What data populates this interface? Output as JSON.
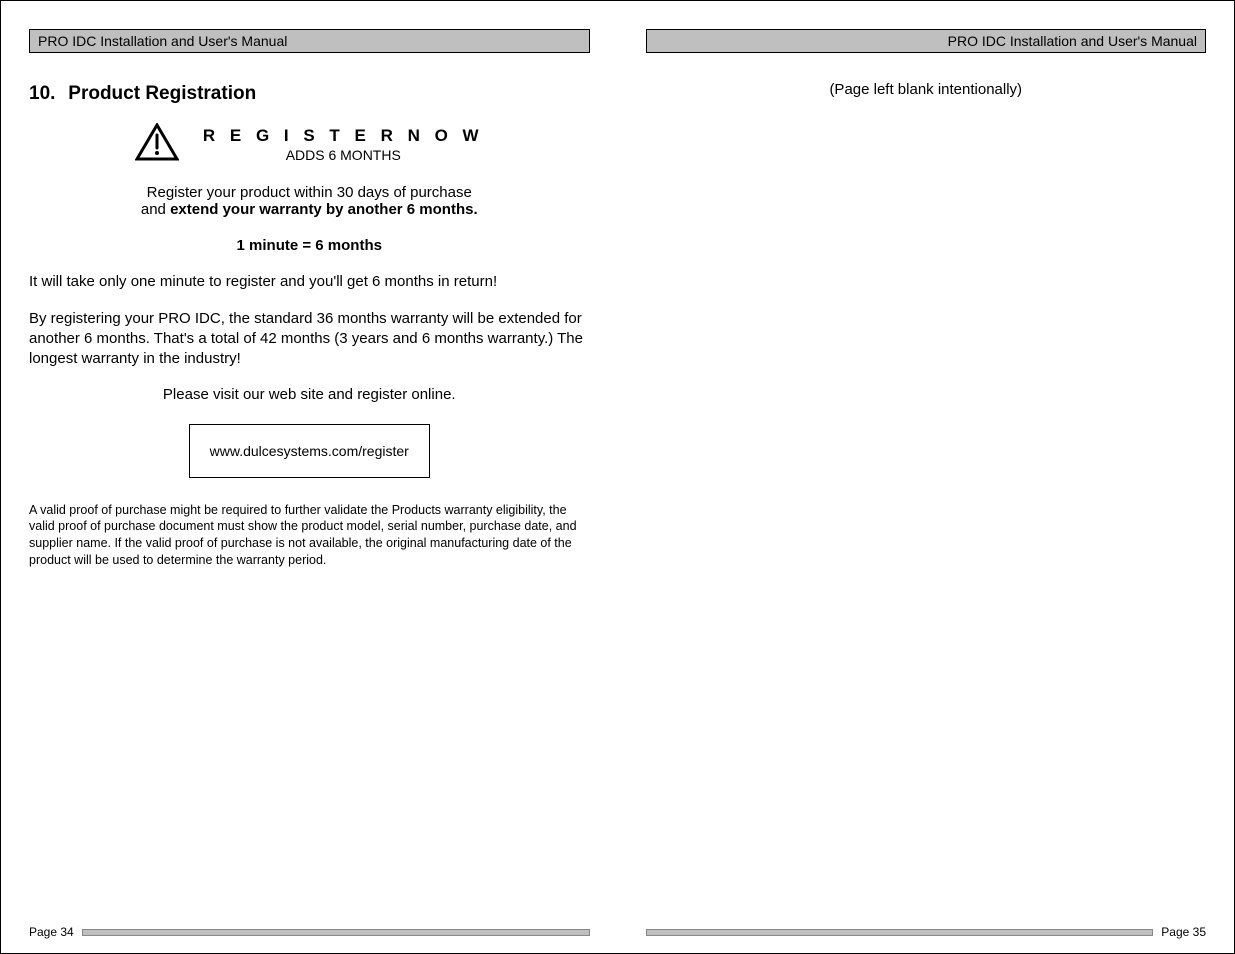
{
  "left": {
    "header": "PRO IDC Installation and User's Manual",
    "section_number": "10.",
    "section_title": "Product Registration",
    "register_now": "R E G I S T E R   N O W",
    "adds_months": "ADDS 6 MONTHS",
    "intro_line1": "Register your product within 30 days of purchase",
    "intro_line2_pre": "and ",
    "intro_line2_bold": "extend your warranty by another 6 months.",
    "equation": "1 minute = 6 months",
    "paragraph1": "It will take only one minute to register and you'll get 6 months in return!",
    "paragraph2": "By registering your PRO IDC, the standard 36 months warranty will be extended for another 6 months.  That's a total of 42 months (3 years and 6 months warranty.)  The longest warranty in the industry!",
    "visit_line": "Please visit our web site and register online.",
    "url": "www.dulcesystems.com/register",
    "fineprint": "A valid proof of purchase might be required to further validate the Products warranty eligibility, the valid proof of purchase document must show the product model, serial number, purchase date, and supplier name. If the valid proof of purchase is not available, the original manufacturing date of the product will be used to determine the warranty period.",
    "page_label": "Page 34"
  },
  "right": {
    "header": "PRO IDC Installation and User's Manual",
    "blank_note": "(Page left blank intentionally)",
    "page_label": "Page 35"
  }
}
